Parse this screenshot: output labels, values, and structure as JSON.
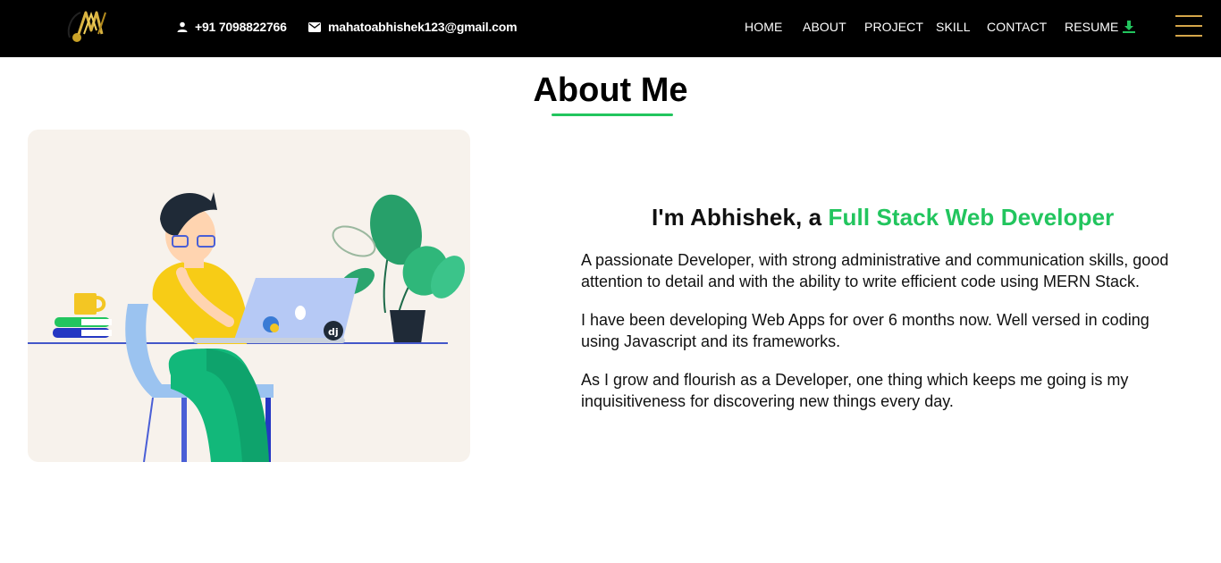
{
  "header": {
    "logo_icon": "gold-monogram-logo",
    "phone": "+91 7098822766",
    "email": "mahatoabhishek123@gmail.com",
    "nav": {
      "home": "HOME",
      "about": "ABOUT",
      "project": "PROJECT",
      "skill": "SKILL",
      "contact": "CONTACT",
      "resume": "RESUME"
    },
    "resume_icon": "download-icon",
    "menu_icon": "hamburger-menu-icon"
  },
  "about": {
    "title": "About Me",
    "headline_prefix": "I'm Abhishek, a ",
    "headline_highlight": "Full Stack Web Developer",
    "paragraphs": [
      "A passionate Developer, with strong administrative and communication skills, good attention to detail and with the ability to write efficient code using MERN Stack.",
      "I have been developing Web Apps for over 6 months now. Well versed in coding using Javascript and its frameworks.",
      "As I grow and flourish as a Developer, one thing which keeps me going is my inquisitiveness for discovering new things every day."
    ],
    "illustration": "developer-at-laptop-illustration"
  },
  "colors": {
    "nav_bg": "#000000",
    "accent_green": "#22c55e",
    "accent_gold": "#d4a64a",
    "illustration_bg": "#f7f2ec"
  }
}
